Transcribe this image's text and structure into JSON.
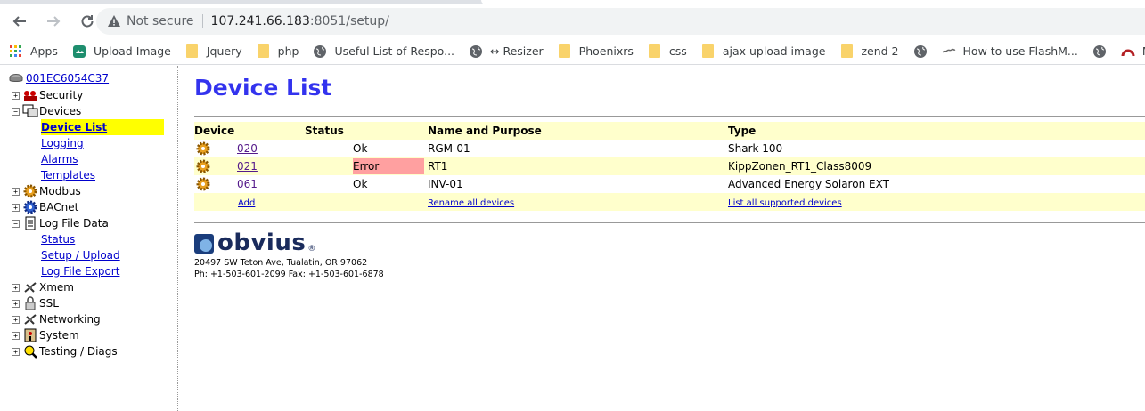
{
  "browser": {
    "security_label": "Not secure",
    "url_host": "107.241.66.183",
    "url_path": ":8051/setup/",
    "bookmarks": [
      {
        "label": "Apps",
        "icon": "apps-grid-icon"
      },
      {
        "label": "Upload Image",
        "icon": "upload-icon"
      },
      {
        "label": "Jquery",
        "icon": "folder-icon"
      },
      {
        "label": "php",
        "icon": "folder-icon"
      },
      {
        "label": "Useful List of Respo...",
        "icon": "globe-icon"
      },
      {
        "label": "↔ Resizer",
        "icon": "globe-icon"
      },
      {
        "label": "Phoenixrs",
        "icon": "folder-icon"
      },
      {
        "label": "css",
        "icon": "folder-icon"
      },
      {
        "label": "ajax upload image",
        "icon": "folder-icon"
      },
      {
        "label": "zend 2",
        "icon": "folder-icon"
      },
      {
        "label": "",
        "icon": "globe-icon"
      },
      {
        "label": "How to use FlashM...",
        "icon": "wave-icon"
      },
      {
        "label": "",
        "icon": "globe-icon"
      },
      {
        "label": "My page - Redmine",
        "icon": "redmine-icon"
      }
    ]
  },
  "sidebar": {
    "root_label": "001EC6054C37",
    "nodes": {
      "security": "Security",
      "devices": "Devices",
      "modbus": "Modbus",
      "bacnet": "BACnet",
      "logfile": "Log File Data",
      "xmem": "Xmem",
      "ssl": "SSL",
      "networking": "Networking",
      "system": "System",
      "testing": "Testing / Diags"
    },
    "devices_children": {
      "device_list": "Device List",
      "logging": "Logging",
      "alarms": "Alarms",
      "templates": "Templates"
    },
    "logfile_children": {
      "status": "Status",
      "setup_upload": "Setup / Upload",
      "export": "Log File Export"
    }
  },
  "main": {
    "title": "Device List",
    "columns": {
      "device": "Device",
      "status": "Status",
      "name": "Name and Purpose",
      "type": "Type"
    },
    "rows": [
      {
        "device": "020",
        "status": "Ok",
        "name": "RGM-01",
        "type": "Shark 100"
      },
      {
        "device": "021",
        "status": "Error",
        "name": "RT1",
        "type": "KippZonen_RT1_Class8009"
      },
      {
        "device": "061",
        "status": "Ok",
        "name": "INV-01",
        "type": "Advanced Energy Solaron EXT"
      }
    ],
    "footer_links": {
      "add": "Add",
      "rename": "Rename all devices",
      "list_supported": "List all supported devices"
    },
    "logo_text": "obvius",
    "logo_reg": "®",
    "address_line1": "20497 SW Teton Ave, Tualatin, OR 97062",
    "address_line2": "Ph: +1-503-601-2099 Fax: +1-503-601-6878"
  }
}
